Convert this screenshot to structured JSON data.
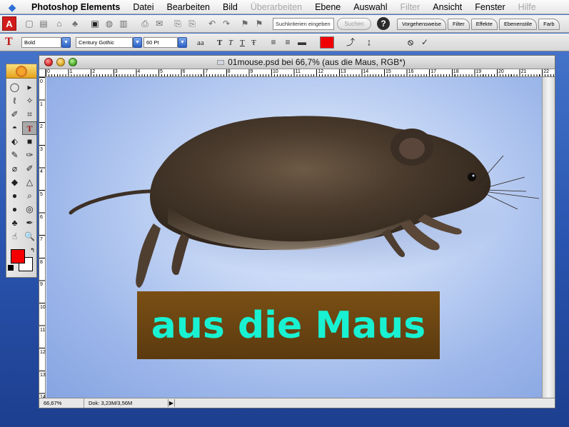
{
  "menubar": {
    "app": "Photoshop Elements",
    "items": [
      "Datei",
      "Bearbeiten",
      "Bild",
      "Überarbeiten",
      "Ebene",
      "Auswahl",
      "Filter",
      "Ansicht",
      "Fenster",
      "Hilfe"
    ],
    "disabled": [
      "Überarbeiten",
      "Filter",
      "Hilfe"
    ]
  },
  "shortcuts": {
    "search_placeholder": "Suchkriterien eingeben",
    "search_button": "Suchen",
    "help_icon": "help-icon",
    "palette_tabs": [
      "Vorgehensweise",
      "Filter",
      "Effekte",
      "Ebenenstile",
      "Farb"
    ]
  },
  "options": {
    "font_style": "Bold",
    "font_family": "Century Gothic",
    "font_size": "60 Pt",
    "antialias_label": "aa",
    "style_buttons": [
      "T",
      "T",
      "T",
      "Ŧ"
    ],
    "text_color": "#f00000",
    "cancel_icon": "⦸",
    "commit_icon": "✓"
  },
  "toolbox": {
    "tools": [
      "◯",
      "▸",
      "ℓ",
      "✧",
      "✐",
      "⌗",
      "◓",
      "T",
      "⬖",
      "■",
      "✎",
      "✑",
      "⌀",
      "✐",
      "◆",
      "△",
      "●",
      "⌕",
      "●",
      "◎",
      "♣",
      "✒",
      "☝",
      "🔍"
    ],
    "foreground": "#f40000",
    "background": "#ffffff"
  },
  "document": {
    "title": "01mouse.psd bei 66,7% (aus die Maus, RGB*)",
    "ruler_numbers": [
      "0",
      "1",
      "2",
      "3",
      "4",
      "5",
      "6",
      "7",
      "8",
      "9",
      "10",
      "11",
      "12",
      "13",
      "14",
      "15",
      "16",
      "17",
      "18",
      "19",
      "20",
      "21",
      "22"
    ],
    "vruler_numbers": [
      "0",
      "1",
      "2",
      "3",
      "4",
      "5",
      "6",
      "7",
      "8",
      "9",
      "10",
      "11",
      "12",
      "13",
      "14"
    ],
    "text_layer": "aus die Maus",
    "text_color": "#18f2d2",
    "zoom": "66,67%",
    "doc_size": "Dok: 3,23M/3,56M"
  }
}
